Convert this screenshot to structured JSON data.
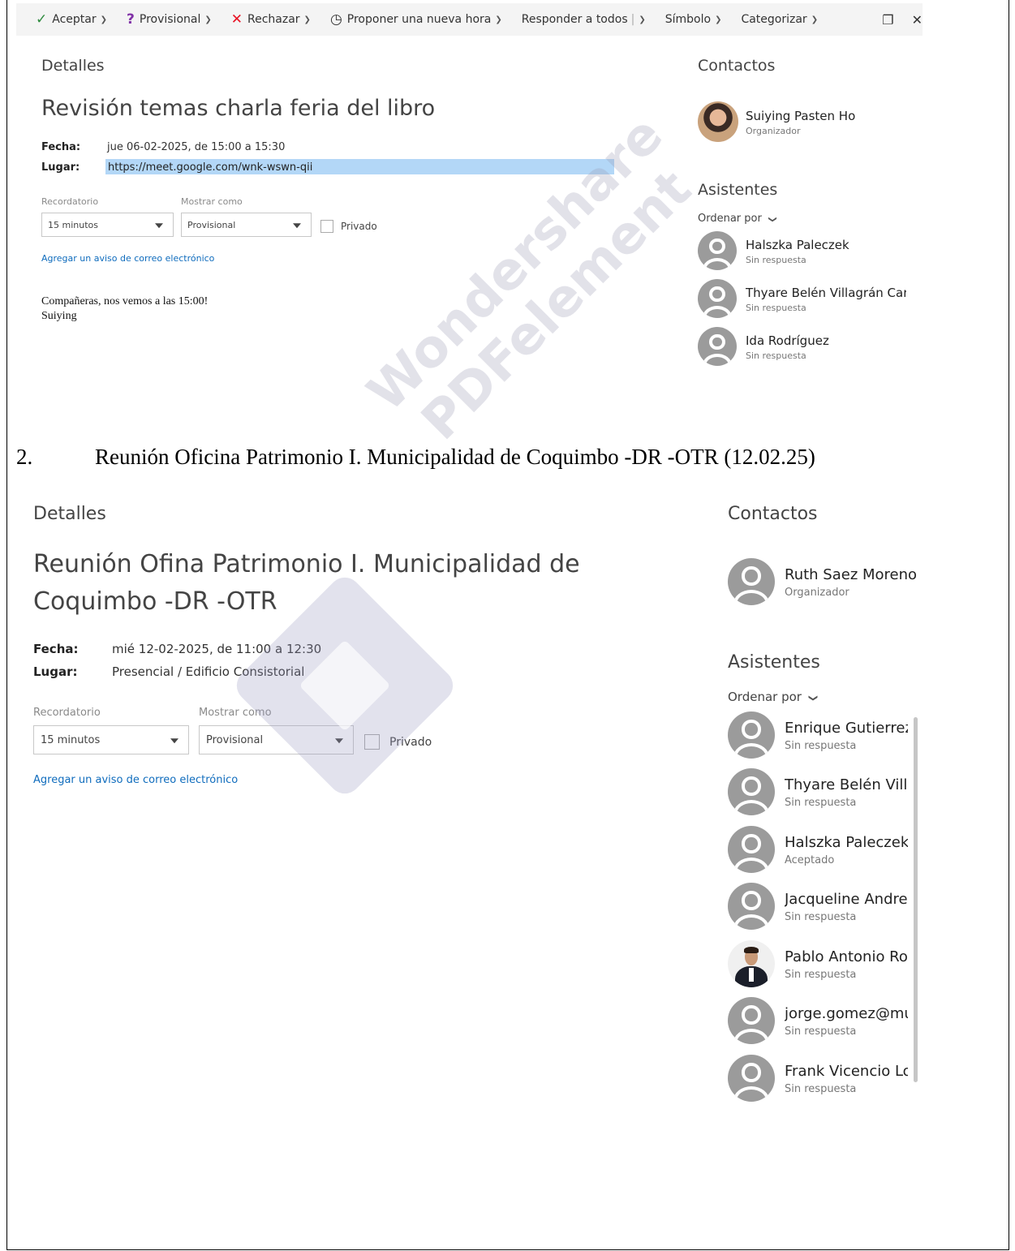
{
  "toolbar": {
    "accept": "Aceptar",
    "tentative": "Provisional",
    "decline": "Rechazar",
    "propose": "Proponer una nueva hora",
    "reply_all": "Responder a todos",
    "symbol": "Símbolo",
    "categorize": "Categorizar",
    "icons": [
      "check-icon",
      "question-icon",
      "x-icon",
      "clock-icon",
      "popout-icon",
      "close-icon"
    ]
  },
  "event1": {
    "details_heading": "Detalles",
    "title": "Revisión temas charla feria del libro",
    "date_label": "Fecha:",
    "date_value": "jue 06-02-2025, de 15:00 a 15:30",
    "place_label": "Lugar:",
    "place_value": "https://meet.google.com/wnk-wswn-qii",
    "reminder_label": "Recordatorio",
    "reminder_value": "15 minutos",
    "show_as_label": "Mostrar como",
    "show_as_value": "Provisional",
    "private_label": "Privado",
    "add_email_link": "Agregar un aviso de correo electrónico",
    "body_line1": "Compañeras, nos vemos a las 15:00!",
    "body_line2": "Suiying",
    "contacts_heading": "Contactos",
    "organizer": {
      "name": "Suiying Pasten Ho",
      "role": "Organizador"
    },
    "attendees_heading": "Asistentes",
    "sort_by": "Ordenar por",
    "attendees": [
      {
        "name": "Halszka Paleczek",
        "status": "Sin respuesta"
      },
      {
        "name": "Thyare Belén Villagrán Caro",
        "status": "Sin respuesta"
      },
      {
        "name": "Ida Rodríguez",
        "status": "Sin respuesta"
      }
    ]
  },
  "doc_heading": {
    "number": "2.",
    "text": "Reunión Oficina Patrimonio I. Municipalidad de Coquimbo -DR -OTR (12.02.25)"
  },
  "event2": {
    "details_heading": "Detalles",
    "title_line1": "Reunión Ofina Patrimonio I. Municipalidad de",
    "title_line2": "Coquimbo -DR -OTR",
    "date_label": "Fecha:",
    "date_value": "mié 12-02-2025, de 11:00 a 12:30",
    "place_label": "Lugar:",
    "place_value": "Presencial / Edificio Consistorial",
    "reminder_label": "Recordatorio",
    "reminder_value": "15 minutos",
    "show_as_label": "Mostrar como",
    "show_as_value": "Provisional",
    "private_label": "Privado",
    "add_email_link": "Agregar un aviso de correo electrónico",
    "contacts_heading": "Contactos",
    "organizer": {
      "name": "Ruth Saez Moreno",
      "role": "Organizador"
    },
    "attendees_heading": "Asistentes",
    "sort_by": "Ordenar por",
    "attendees": [
      {
        "name": "Enrique Gutierrez",
        "status": "Sin respuesta"
      },
      {
        "name": "Thyare Belén Villa",
        "status": "Sin respuesta"
      },
      {
        "name": "Halszka Paleczek",
        "status": "Aceptado"
      },
      {
        "name": "Jacqueline Andrea",
        "status": "Sin respuesta"
      },
      {
        "name": "Pablo Antonio Ro",
        "status": "Sin respuesta"
      },
      {
        "name": "jorge.gomez@mu",
        "status": "Sin respuesta"
      },
      {
        "name": "Frank Vicencio Lo",
        "status": "Sin respuesta"
      }
    ]
  },
  "watermark": {
    "line1": "Wondershare",
    "line2": "PDFelement"
  },
  "colors": {
    "link": "#0f6cbd",
    "highlight": "#b3d7f7",
    "accept": "#2e8b3e",
    "decline": "#e81123",
    "tentative": "#8031a7"
  }
}
